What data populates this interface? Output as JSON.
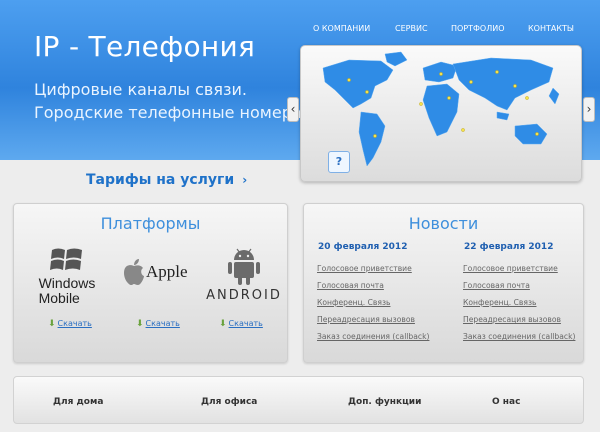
{
  "header": {
    "title": "IP - Телефония",
    "tagline_1": "Цифровые каналы связи.",
    "tagline_2": "Городские телефонные номера"
  },
  "nav": {
    "items": [
      {
        "label": "О КОМПАНИИ"
      },
      {
        "label": "СЕРВИС"
      },
      {
        "label": "ПОРТФОЛИО"
      },
      {
        "label": "КОНТАКТЫ"
      }
    ]
  },
  "slider": {
    "prev_glyph": "‹",
    "next_glyph": "›",
    "help_label": "?"
  },
  "tariffs": {
    "label": "Тарифы на услуги",
    "chevron": "›"
  },
  "platforms": {
    "title": "Платформы",
    "windows": {
      "line1": "Windows",
      "line2": "Mobile"
    },
    "apple": {
      "label": "Apple"
    },
    "android": {
      "label": "ANDROID"
    },
    "download_label": "Скачать"
  },
  "news": {
    "title": "Новости",
    "columns": [
      {
        "date": "20 февраля 2012",
        "links": [
          "Голосовое приветствие",
          "Голосовая почта",
          "Конференц. Связь",
          "Переадресация вызовов",
          "Заказ соединения (callback)"
        ]
      },
      {
        "date": "22 февраля 2012",
        "links": [
          "Голосовое приветствие",
          "Голосовая почта",
          "Конференц. Связь",
          "Переадресация вызовов",
          "Заказ соединения (callback)"
        ]
      }
    ]
  },
  "footer": {
    "items": [
      {
        "label": "Для дома"
      },
      {
        "label": "Для офиса"
      },
      {
        "label": "Доп. функции"
      },
      {
        "label": "О нас"
      }
    ]
  },
  "colors": {
    "header_blue": "#3a8fe5",
    "link_blue": "#1f72c9",
    "title_blue": "#3e8fdc",
    "map_blue": "#2c8ae8"
  }
}
